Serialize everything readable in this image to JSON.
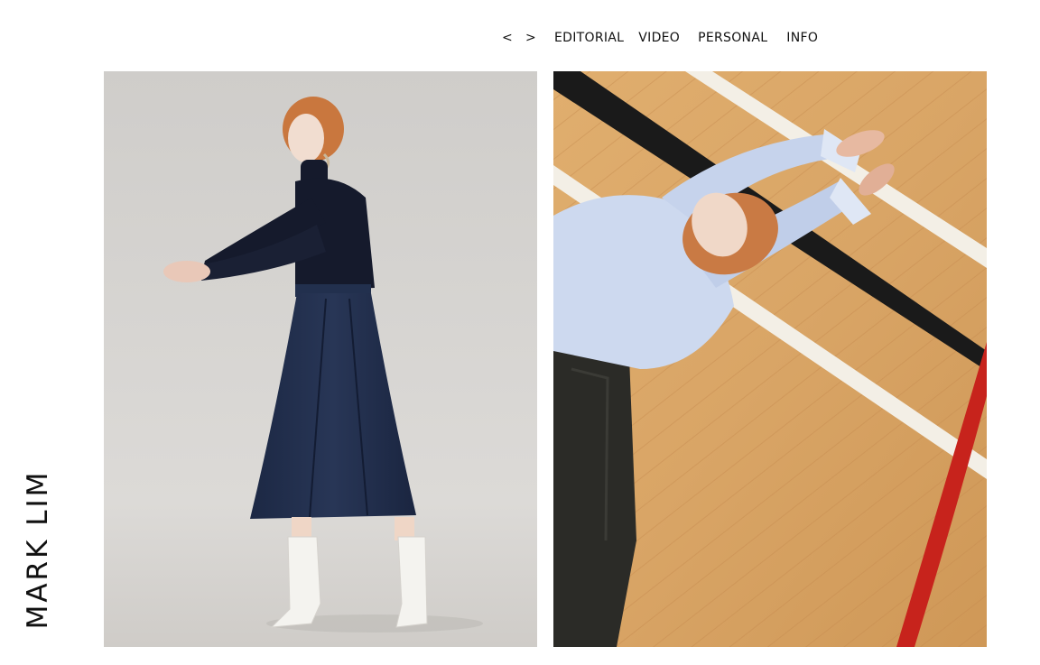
{
  "site": {
    "logo_text": "MARK LIM"
  },
  "nav": {
    "prev_label": "<",
    "next_label": ">",
    "links": [
      {
        "label": "EDITORIAL"
      },
      {
        "label": "VIDEO"
      },
      {
        "label": "PERSONAL"
      },
      {
        "label": "INFO"
      }
    ]
  },
  "gallery": {
    "photos": [
      {
        "subject": "model-standing-studio"
      },
      {
        "subject": "model-lying-on-court-floor"
      }
    ]
  },
  "colors": {
    "background": "#ffffff",
    "text": "#111111",
    "studio_backdrop": "#d6d4d1",
    "navy_garment": "#1f2b47",
    "floor_wood": "#d9a566",
    "court_red": "#c7231c",
    "shirt_blue": "#cdd9ef"
  }
}
